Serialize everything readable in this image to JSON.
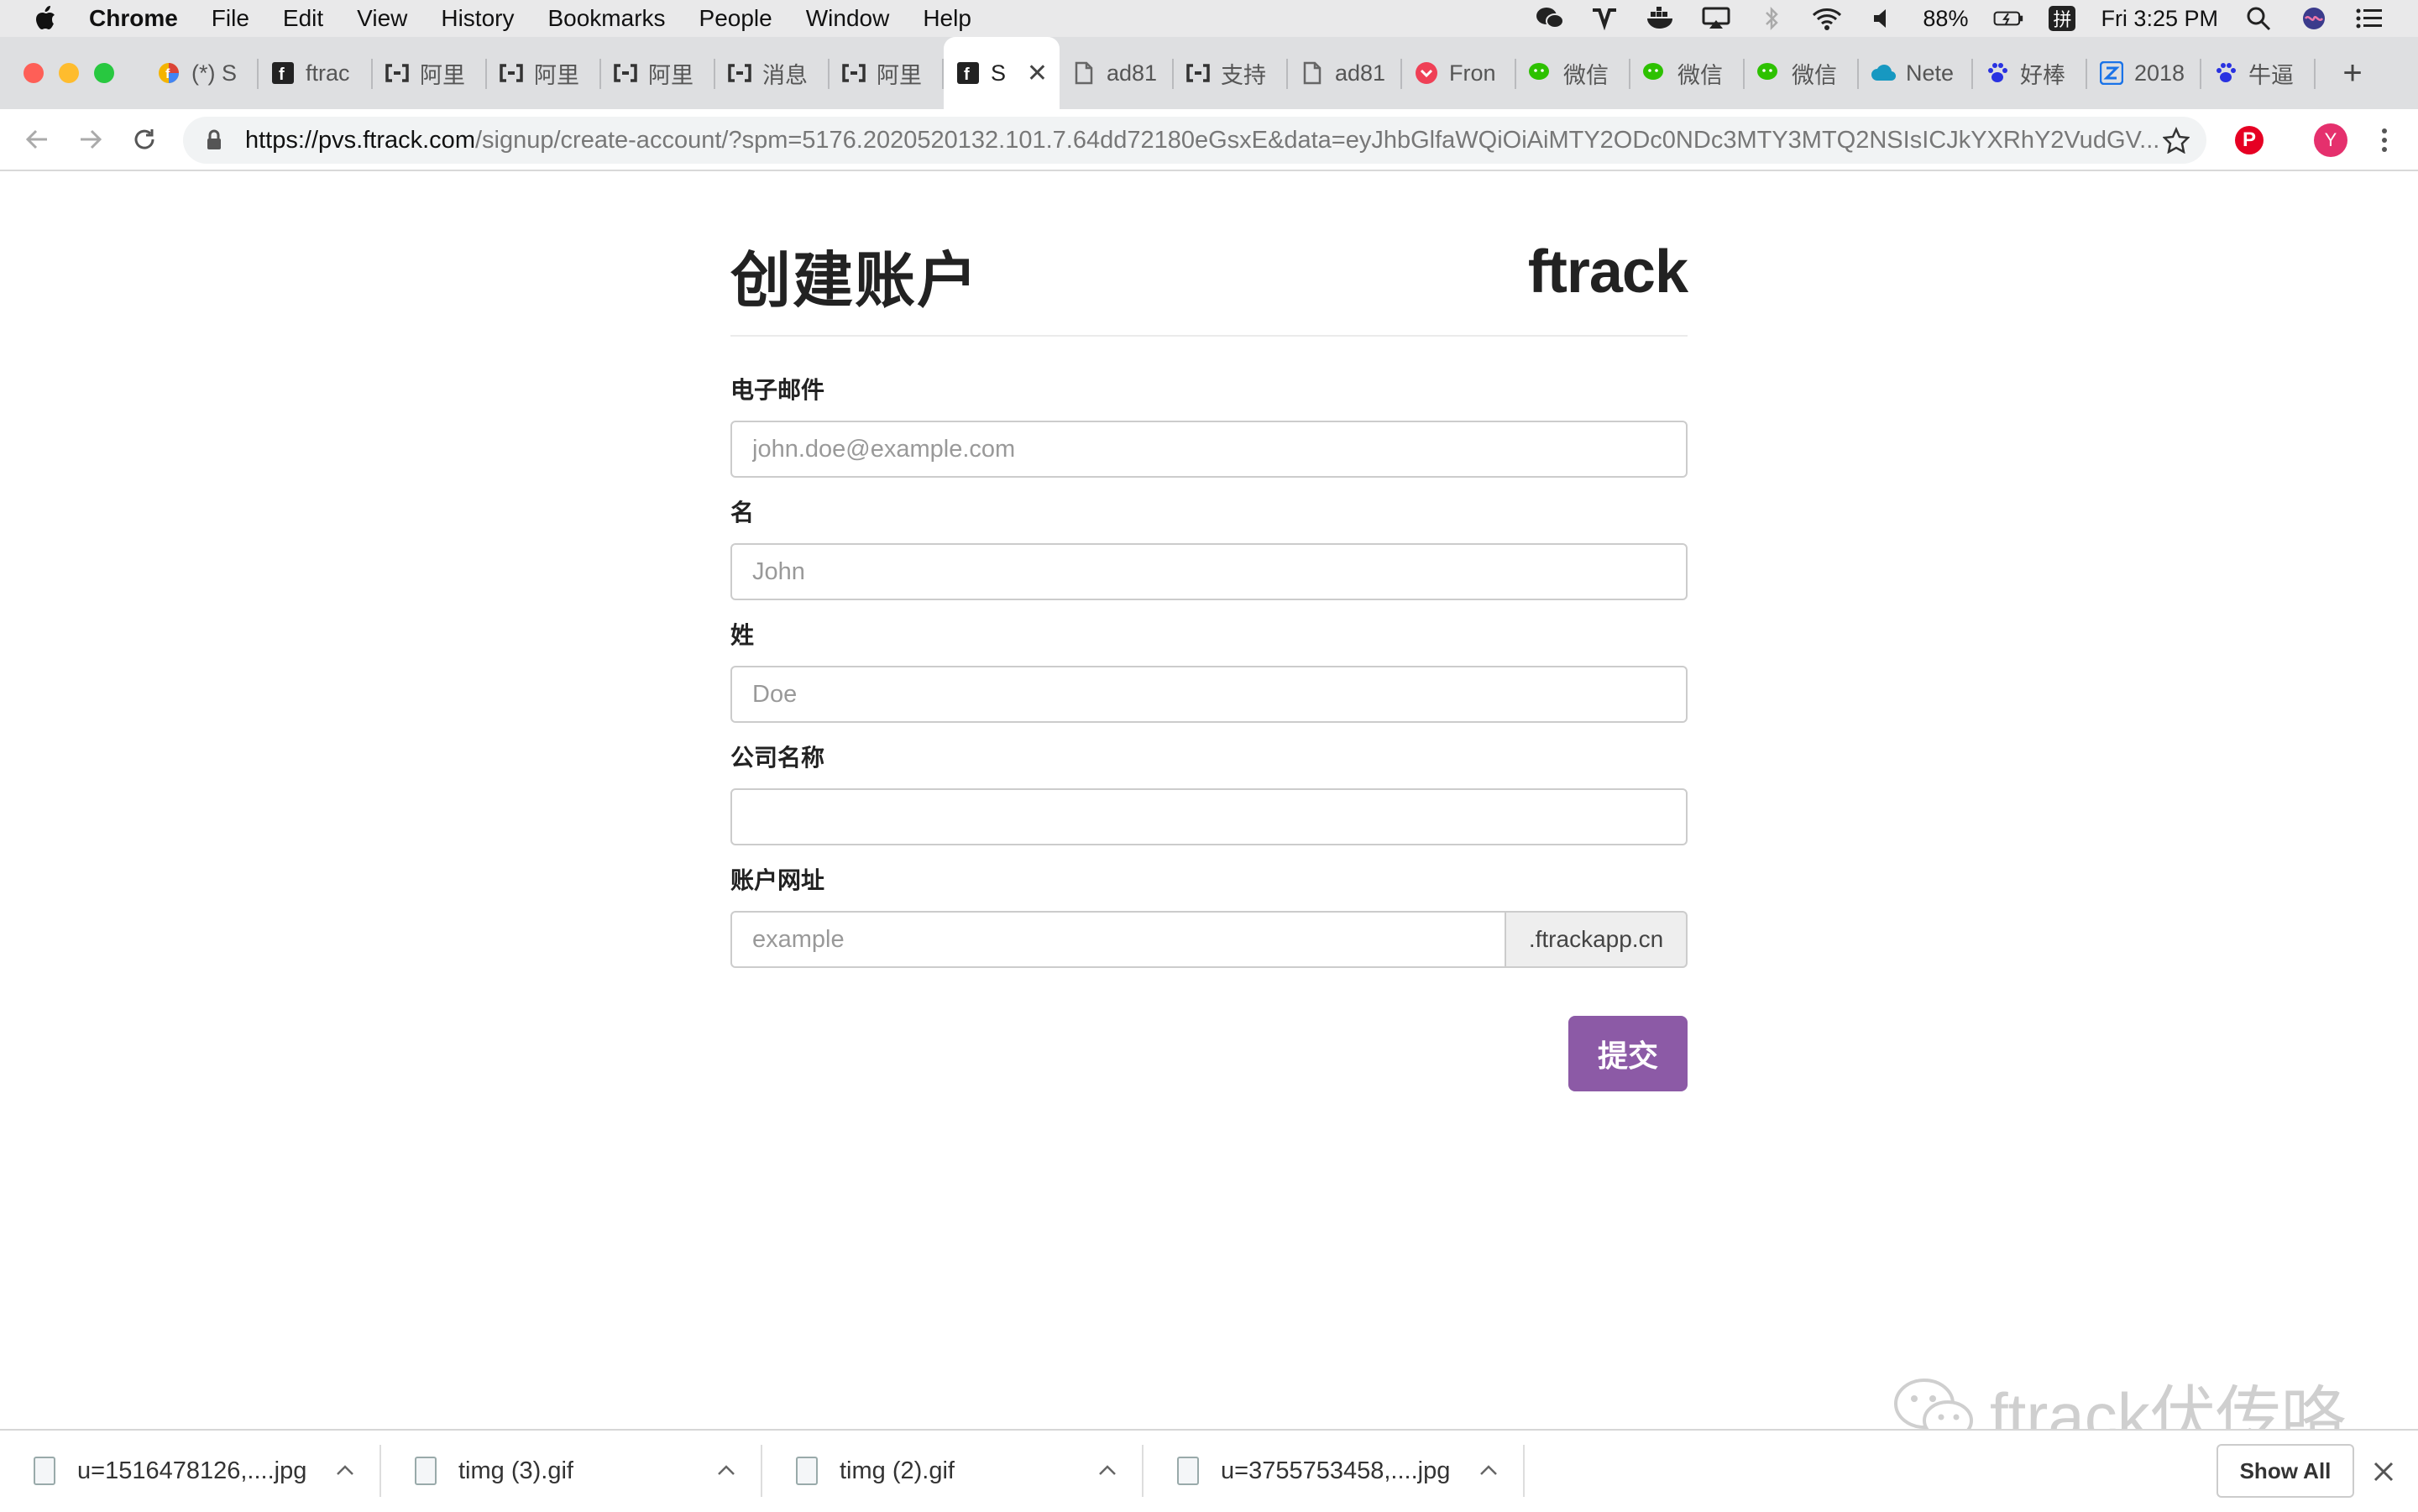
{
  "menubar": {
    "app": "Chrome",
    "items": [
      "File",
      "Edit",
      "View",
      "History",
      "Bookmarks",
      "People",
      "Window",
      "Help"
    ],
    "battery": "88%",
    "input_method": "拼",
    "clock": "Fri 3:25 PM"
  },
  "tabs": [
    {
      "label": "(*) S",
      "icon": "colorful-f-icon"
    },
    {
      "label": "ftrac",
      "icon": "ftrack-f-icon"
    },
    {
      "label": "阿里",
      "icon": "aliyun-icon"
    },
    {
      "label": "阿里",
      "icon": "aliyun-icon"
    },
    {
      "label": "阿里",
      "icon": "aliyun-icon"
    },
    {
      "label": "消息",
      "icon": "aliyun-icon"
    },
    {
      "label": "阿里",
      "icon": "aliyun-icon"
    },
    {
      "label": "S",
      "icon": "ftrack-f-icon",
      "active": true
    },
    {
      "label": "ad81",
      "icon": "document-icon"
    },
    {
      "label": "支持",
      "icon": "aliyun-icon"
    },
    {
      "label": "ad81",
      "icon": "document-icon"
    },
    {
      "label": "Fron",
      "icon": "pocket-icon"
    },
    {
      "label": "微信",
      "icon": "wechat-icon"
    },
    {
      "label": "微信",
      "icon": "wechat-icon"
    },
    {
      "label": "微信",
      "icon": "wechat-icon"
    },
    {
      "label": "Nete",
      "icon": "cloud-icon"
    },
    {
      "label": "好棒",
      "icon": "baidu-paw-icon"
    },
    {
      "label": "2018",
      "icon": "z-icon"
    },
    {
      "label": "牛逼",
      "icon": "baidu-paw-icon"
    }
  ],
  "address": {
    "host": "https://pvs.ftrack.com",
    "path": "/signup/create-account/?spm=5176.2020520132.101.7.64dd72180eGsxE&data=eyJhbGlfaWQiOiAiMTY2ODc0NDc3MTY3MTQ2NSIsICJkYXRhY2VudGV..."
  },
  "profile_initial": "Y",
  "page": {
    "title": "创建账户",
    "logo": "ftrack",
    "fields": {
      "email": {
        "label": "电子邮件",
        "placeholder": "john.doe@example.com",
        "value": ""
      },
      "first_name": {
        "label": "名",
        "placeholder": "John",
        "value": ""
      },
      "last_name": {
        "label": "姓",
        "placeholder": "Doe",
        "value": ""
      },
      "company": {
        "label": "公司名称",
        "placeholder": "",
        "value": ""
      },
      "account_url": {
        "label": "账户网址",
        "placeholder": "example",
        "value": "",
        "suffix": ".ftrackapp.cn"
      }
    },
    "submit_label": "提交",
    "accent": "#8c5aa6"
  },
  "watermark": "ftrack伏传咯",
  "downloads": {
    "items": [
      "u=1516478126,....jpg",
      "timg (3).gif",
      "timg (2).gif",
      "u=3755753458,....jpg"
    ],
    "show_all": "Show All"
  }
}
